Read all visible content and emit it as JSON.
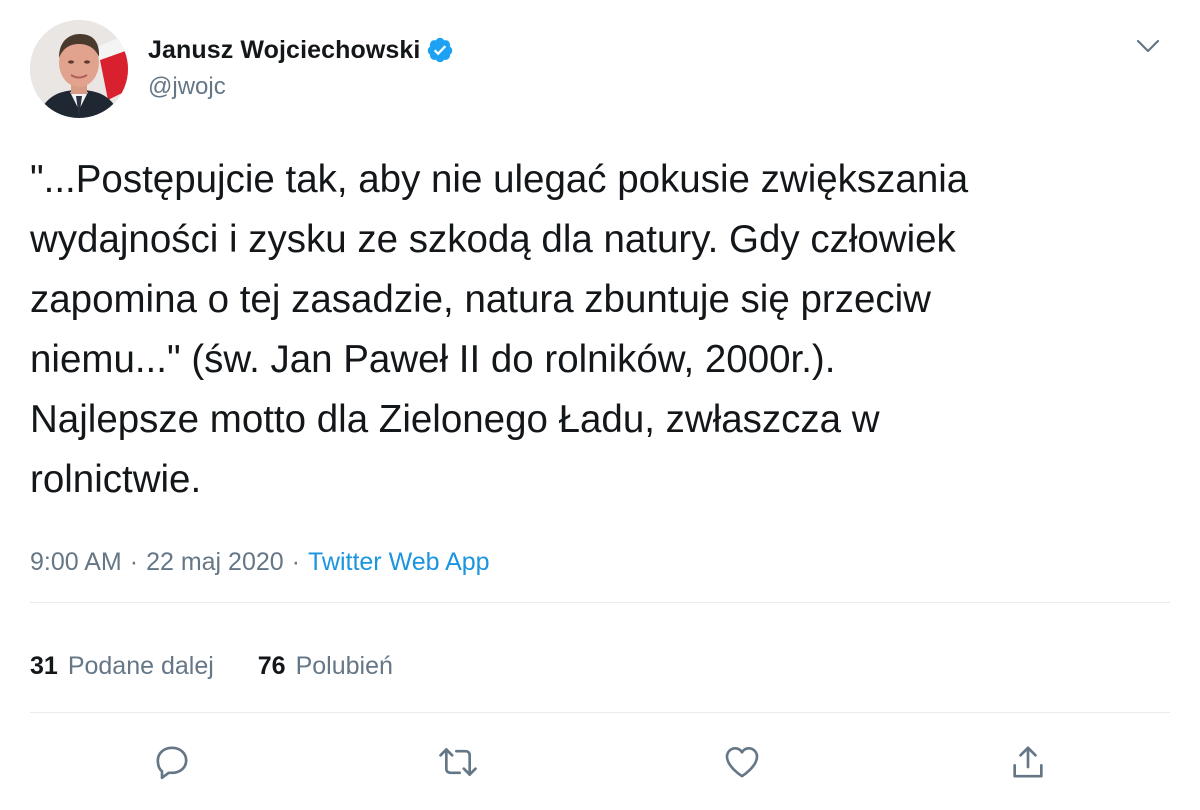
{
  "author": {
    "display_name": "Janusz Wojciechowski",
    "handle": "@jwojc",
    "verified": true,
    "avatar_icon": "avatar-photo"
  },
  "tweet": {
    "text": "\"...Postępujcie tak, aby nie ulegać pokusie zwiększania\nwydajności i zysku ze szkodą dla natury. Gdy człowiek\nzapomina o tej zasadzie, natura zbuntuje się przeciw\nniemu...\" (św. Jan Paweł II do rolników, 2000r.).\nNajlepsze motto dla Zielonego Ładu, zwłaszcza w\nrolnictwie.",
    "time": "9:00 AM",
    "date": "22 maj 2020",
    "separator": "·",
    "source": "Twitter Web App"
  },
  "stats": {
    "retweets_count": "31",
    "retweets_label": "Podane dalej",
    "likes_count": "76",
    "likes_label": "Polubień"
  },
  "actions": [
    {
      "name": "reply",
      "icon": "reply-icon"
    },
    {
      "name": "retweet",
      "icon": "retweet-icon"
    },
    {
      "name": "like",
      "icon": "heart-icon"
    },
    {
      "name": "share",
      "icon": "share-icon"
    }
  ],
  "colors": {
    "text": "#14171a",
    "secondary": "#657786",
    "link": "#1b95e0",
    "verified": "#1da1f2",
    "divider": "#e6ecf0"
  }
}
